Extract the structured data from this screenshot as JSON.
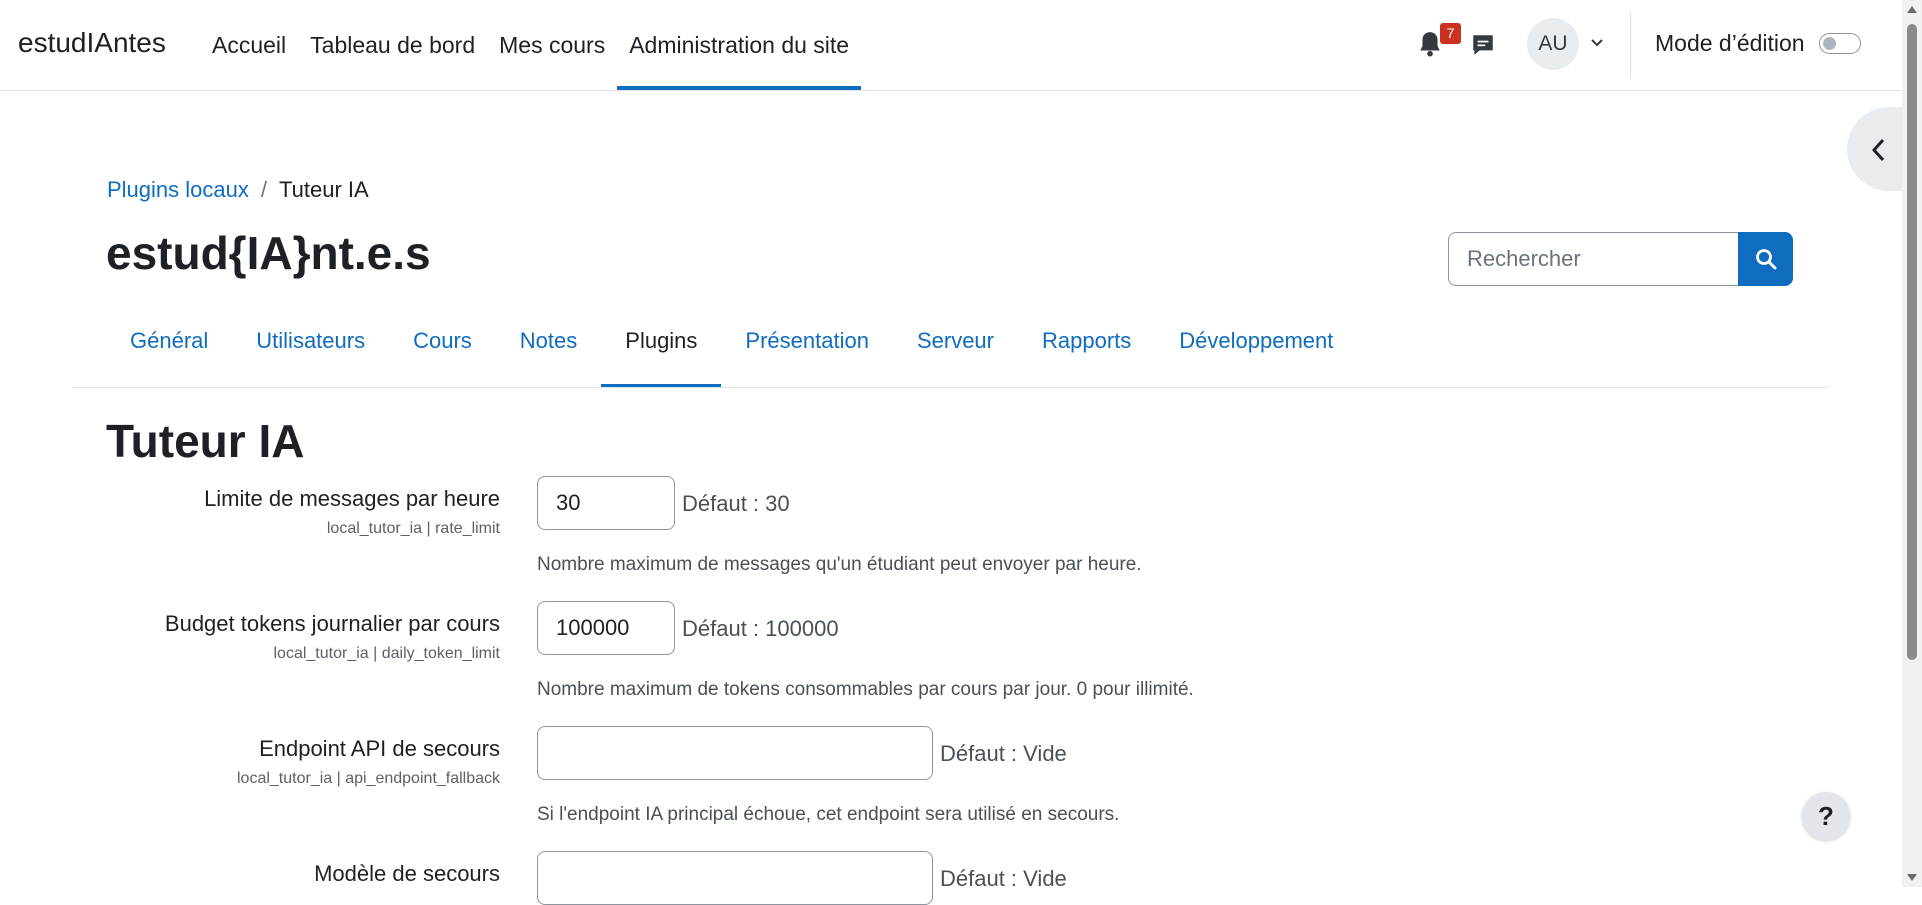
{
  "navbar": {
    "brand": "estudIAntes",
    "links": [
      {
        "label": "Accueil",
        "active": false
      },
      {
        "label": "Tableau de bord",
        "active": false
      },
      {
        "label": "Mes cours",
        "active": false
      },
      {
        "label": "Administration du site",
        "active": true
      }
    ],
    "notification_count": "7",
    "avatar_initials": "AU",
    "edit_mode_label": "Mode d’édition",
    "edit_mode_on": false
  },
  "breadcrumb": {
    "parent": "Plugins locaux",
    "separator": "/",
    "current": "Tuteur IA"
  },
  "site_title": "estud{IA}nt.e.s",
  "search": {
    "placeholder": "Rechercher",
    "value": ""
  },
  "tabs": [
    {
      "label": "Général",
      "active": false
    },
    {
      "label": "Utilisateurs",
      "active": false
    },
    {
      "label": "Cours",
      "active": false
    },
    {
      "label": "Notes",
      "active": false
    },
    {
      "label": "Plugins",
      "active": true
    },
    {
      "label": "Présentation",
      "active": false
    },
    {
      "label": "Serveur",
      "active": false
    },
    {
      "label": "Rapports",
      "active": false
    },
    {
      "label": "Développement",
      "active": false
    }
  ],
  "page_heading": "Tuteur IA",
  "settings": [
    {
      "label": "Limite de messages par heure",
      "key": "local_tutor_ia | rate_limit",
      "value": "30",
      "default": "Défaut : 30",
      "description": "Nombre maximum de messages qu'un étudiant peut envoyer par heure."
    },
    {
      "label": "Budget tokens journalier par cours",
      "key": "local_tutor_ia | daily_token_limit",
      "value": "100000",
      "default": "Défaut : 100000",
      "description": "Nombre maximum de tokens consommables par cours par jour. 0 pour illimité."
    },
    {
      "label": "Endpoint API de secours",
      "key": "local_tutor_ia | api_endpoint_fallback",
      "value": "",
      "default": "Défaut : Vide",
      "description": "Si l'endpoint IA principal échoue, cet endpoint sera utilisé en secours."
    },
    {
      "label": "Modèle de secours",
      "key": "",
      "value": "",
      "default": "Défaut : Vide",
      "description": ""
    }
  ],
  "help_label": "?",
  "colors": {
    "accent": "#0f6cbf",
    "text": "#1d2125",
    "badge": "#ca3120"
  }
}
